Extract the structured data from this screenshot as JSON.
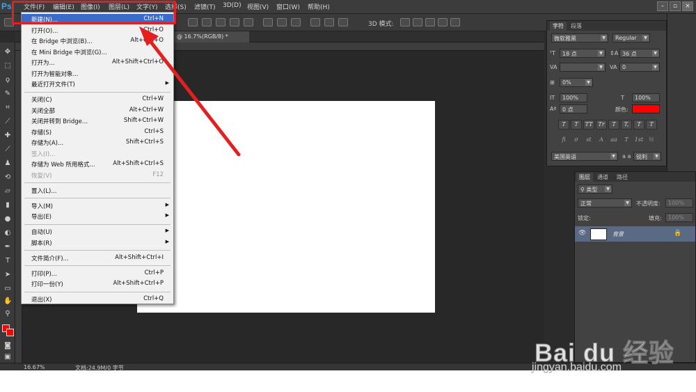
{
  "menubar": {
    "logo": "Ps",
    "items": [
      "文件(F)",
      "编辑(E)",
      "图像(I)",
      "图层(L)",
      "文字(Y)",
      "选择(S)",
      "滤镜(T)",
      "3D(D)",
      "视图(V)",
      "窗口(W)",
      "帮助(H)"
    ]
  },
  "options_bar": {
    "mode_label": "3D 模式:"
  },
  "document_tab": {
    "title": "@ 16.7%(RGB/8) *"
  },
  "file_menu": {
    "items": [
      {
        "label": "新建(N)...",
        "shortcut": "Ctrl+N",
        "highlight": true
      },
      {
        "label": "打开(O)...",
        "shortcut": "Ctrl+O"
      },
      {
        "label": "在 Bridge 中浏览(B)...",
        "shortcut": "Alt+Ctrl+O"
      },
      {
        "label": "在 Mini Bridge 中浏览(G)...",
        "shortcut": ""
      },
      {
        "label": "打开为...",
        "shortcut": "Alt+Shift+Ctrl+O"
      },
      {
        "label": "打开为智能对象...",
        "shortcut": ""
      },
      {
        "label": "最近打开文件(T)",
        "shortcut": "",
        "submenu": true
      },
      {
        "label": "关闭(C)",
        "shortcut": "Ctrl+W"
      },
      {
        "label": "关闭全部",
        "shortcut": "Alt+Ctrl+W"
      },
      {
        "label": "关闭并转到 Bridge...",
        "shortcut": "Shift+Ctrl+W"
      },
      {
        "label": "存储(S)",
        "shortcut": "Ctrl+S"
      },
      {
        "label": "存储为(A)...",
        "shortcut": "Shift+Ctrl+S"
      },
      {
        "label": "签入(I)...",
        "shortcut": "",
        "disabled": true
      },
      {
        "label": "存储为 Web 所用格式...",
        "shortcut": "Alt+Shift+Ctrl+S"
      },
      {
        "label": "恢复(V)",
        "shortcut": "F12",
        "disabled": true
      },
      {
        "label": "置入(L)...",
        "shortcut": ""
      },
      {
        "label": "导入(M)",
        "shortcut": "",
        "submenu": true
      },
      {
        "label": "导出(E)",
        "shortcut": "",
        "submenu": true
      },
      {
        "label": "自动(U)",
        "shortcut": "",
        "submenu": true
      },
      {
        "label": "脚本(R)",
        "shortcut": "",
        "submenu": true
      },
      {
        "label": "文件简介(F)...",
        "shortcut": "Alt+Shift+Ctrl+I"
      },
      {
        "label": "打印(P)...",
        "shortcut": "Ctrl+P"
      },
      {
        "label": "打印一份(Y)",
        "shortcut": "Alt+Shift+Ctrl+P"
      },
      {
        "label": "退出(X)",
        "shortcut": "Ctrl+Q"
      }
    ]
  },
  "character_panel": {
    "tabs": [
      "字符",
      "段落"
    ],
    "font_family": "微软雅黑",
    "font_style": "Regular",
    "font_size": "18 点",
    "leading": "36 点",
    "kerning": "",
    "tracking": "0",
    "scale_percent": "0%",
    "vertical_scale": "100%",
    "horizontal_scale": "100%",
    "baseline_shift": "0 点",
    "color_label": "颜色:",
    "color_value": "#ff0000",
    "typo_buttons": [
      "T",
      "T",
      "TT",
      "Tr",
      "T",
      "T,",
      "T",
      "T"
    ],
    "ot_buttons": [
      "fi",
      "σ",
      "st",
      "A",
      "aa",
      "T",
      "1st",
      "½"
    ],
    "language": "美国英语",
    "aa_icon": "a a",
    "antialias": "锐利"
  },
  "layers_panel": {
    "tabs": [
      "图层",
      "通道",
      "路径"
    ],
    "filter_kind": "类型",
    "blend_mode": "正常",
    "opacity_label": "不透明度:",
    "opacity_value": "100%",
    "lock_label": "锁定:",
    "fill_label": "填充:",
    "fill_value": "100%",
    "layer_name": "背景"
  },
  "status_bar": {
    "zoom": "16.67%",
    "doc_info": "文档:24.9M/0 字节"
  },
  "watermark": {
    "brand": "Bai du 经验",
    "url": "jingyan.baidu.com"
  },
  "colors": {
    "highlight": "#3a6bc8",
    "annotation": "#e61e1e",
    "foreground": "#ff0000",
    "background": "#ff0000"
  }
}
